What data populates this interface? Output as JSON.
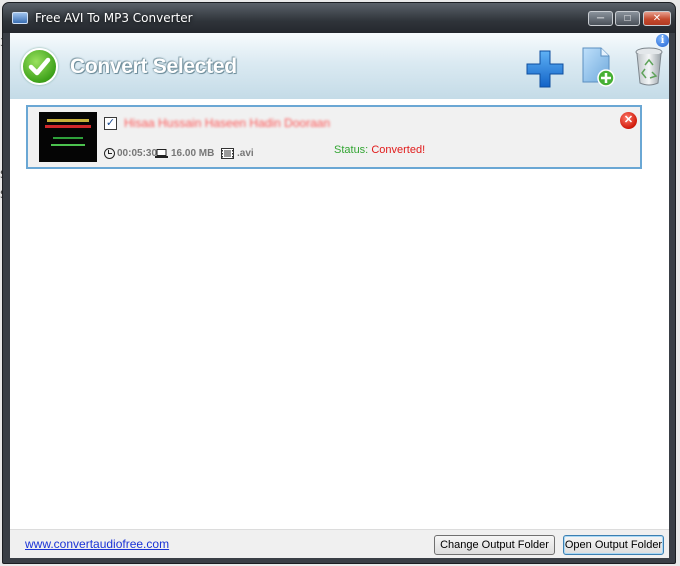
{
  "window": {
    "title": "Free AVI To MP3 Converter",
    "controls": {
      "minimize": "─",
      "maximize": "□",
      "close": "✕"
    }
  },
  "toolbar": {
    "convert_label": "Convert Selected",
    "icons": [
      "check-circle-icon",
      "plus-icon",
      "add-file-icon",
      "trash-icon",
      "info-icon"
    ],
    "info_glyph": "i"
  },
  "items": [
    {
      "filename": "Hisaa Hussain Haseen Hadin Dooraan",
      "checked": true,
      "checkmark": "✓",
      "duration": "00:05:30",
      "size": "16.00 MB",
      "format": ".avi",
      "status_label": "Status:",
      "status_value": "Converted!",
      "remove_glyph": "✕"
    }
  ],
  "footer": {
    "link_text": "www.convertaudiofree.com",
    "change_button": "Change Output Folder",
    "open_button": "Open Output Folder"
  },
  "colors": {
    "accent": "#6aa7d4",
    "status_ok": "#33a533",
    "status_value": "#e11b1b",
    "link": "#1a33d6"
  }
}
